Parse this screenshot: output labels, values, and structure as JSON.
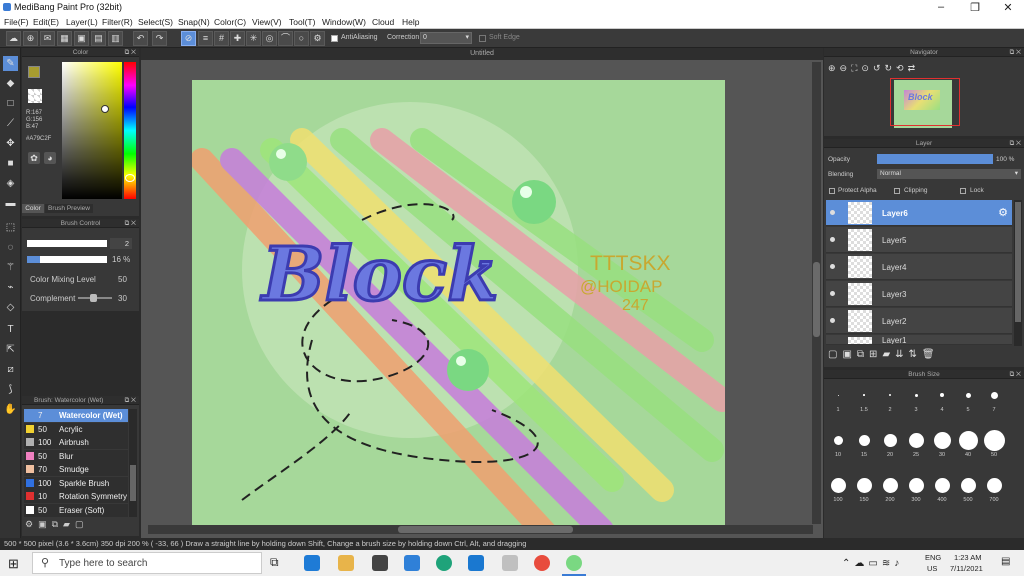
{
  "window": {
    "title": "MediBang Paint Pro (32bit)",
    "minimize": "–",
    "maximize": "❐",
    "close": "✕"
  },
  "menu": [
    "File(F)",
    "Edit(E)",
    "Layer(L)",
    "Filter(R)",
    "Select(S)",
    "Snap(N)",
    "Color(C)",
    "View(V)",
    "Tool(T)",
    "Window(W)",
    "Cloud",
    "Help"
  ],
  "toolbar": {
    "antialiasing": "AntiAliasing",
    "correction": "Correction",
    "correction_value": "0",
    "soft_edge": "Soft Edge"
  },
  "color_panel": {
    "title": "Color",
    "r": "R:167",
    "g": "G:156",
    "b": "B:47",
    "hex": "#A79C2F",
    "tab_color": "Color",
    "tab_preview": "Brush Preview",
    "fg_color": "#A79C2F",
    "bg_color": "#ffffff"
  },
  "brush_control": {
    "title": "Brush Control",
    "size": "2",
    "opacity": "16 %",
    "opacity_fraction": 0.16,
    "mix_label": "Color Mixing Level",
    "mix_value": "50",
    "complement_label": "Complement",
    "complement_value": "30"
  },
  "brush_list": {
    "title": "Brush: Watercolor (Wet)",
    "items": [
      {
        "n": "7",
        "name": "Watercolor (Wet)",
        "color": "#5c8ed8",
        "selected": true
      },
      {
        "n": "50",
        "name": "Acrylic",
        "color": "#f0d030"
      },
      {
        "n": "100",
        "name": "Airbrush",
        "color": "#b0b0b0"
      },
      {
        "n": "50",
        "name": "Blur",
        "color": "#f080c0"
      },
      {
        "n": "70",
        "name": "Smudge",
        "color": "#f0c0a0"
      },
      {
        "n": "100",
        "name": "Sparkle Brush",
        "color": "#3070e0"
      },
      {
        "n": "10",
        "name": "Rotation Symmetry",
        "color": "#e03030"
      },
      {
        "n": "50",
        "name": "Eraser (Soft)",
        "color": "#ffffff"
      }
    ]
  },
  "canvas": {
    "title": "Untitled",
    "art_title": "Block",
    "signature_line1": "TTTSKX",
    "signature_line2": "@HOIDAP",
    "signature_line3": "247"
  },
  "navigator": {
    "title": "Navigator"
  },
  "layer_panel": {
    "title": "Layer",
    "opacity_label": "Opacity",
    "opacity_value": "100 %",
    "blending_label": "Blending",
    "blending_value": "Normal",
    "protect_alpha": "Protect Alpha",
    "clipping": "Clipping",
    "lock": "Lock",
    "layers": [
      {
        "name": "Layer6",
        "selected": true
      },
      {
        "name": "Layer5"
      },
      {
        "name": "Layer4"
      },
      {
        "name": "Layer3"
      },
      {
        "name": "Layer2"
      },
      {
        "name": "Layer1"
      }
    ]
  },
  "brush_size": {
    "title": "Brush Size",
    "labels": [
      "1",
      "1.5",
      "2",
      "3",
      "4",
      "5",
      "7",
      "10",
      "15",
      "20",
      "25",
      "30",
      "40",
      "50",
      "100",
      "150",
      "200",
      "300",
      "400",
      "500",
      "700"
    ]
  },
  "statusbar": {
    "text": "500 * 500 pixel   (3.6 * 3.6cm)   350 dpi   200 %   ( -33, 66 )   Draw a straight line by holding down Shift, Change a brush size by holding down Ctrl, Alt, and dragging"
  },
  "taskbar": {
    "search_placeholder": "Type here to search",
    "lang1": "ENG",
    "lang2": "US",
    "time": "1:23 AM",
    "date": "7/11/2021"
  }
}
